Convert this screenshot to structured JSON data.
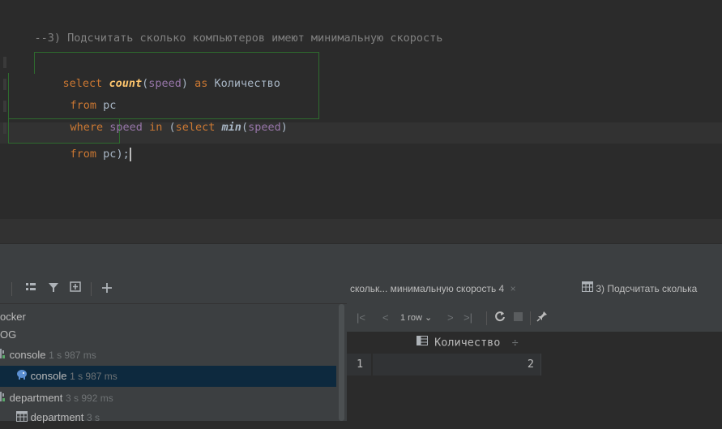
{
  "editor": {
    "comment": "--3) Подсчитать сколько компьютеров имеют минимальную скорость",
    "sql": {
      "kw_select": "select",
      "fn_count": "count",
      "col_speed": "speed",
      "kw_as": "as",
      "alias": "Количество",
      "kw_from": "from",
      "table_pc": "pc",
      "kw_where": "where",
      "kw_in": "in",
      "fn_min": "min",
      "open_paren": "(",
      "close_paren": ")",
      "close_stmt": ");"
    }
  },
  "services": {
    "toolbar_icons": [
      "layout-icon",
      "filter-icon",
      "new-group-icon",
      "add-icon"
    ],
    "tree": [
      {
        "label": "ocker",
        "time": "",
        "icon": "",
        "selected": false
      },
      {
        "label": "OG",
        "time": "",
        "icon": "",
        "selected": false
      },
      {
        "label": "console",
        "time": "1 s 987 ms",
        "icon": "console-session-icon",
        "selected": false
      },
      {
        "label": "console",
        "time": "1 s 987 ms",
        "icon": "postgres-elephant-icon",
        "selected": true
      },
      {
        "label": "department",
        "time": "3 s 992 ms",
        "icon": "console-session-icon",
        "selected": false
      },
      {
        "label": "department",
        "time": "3 s",
        "icon": "table-icon",
        "selected": false
      }
    ]
  },
  "results": {
    "tab1_label": "скольк... минимальную скорость 4",
    "tab1_close": "×",
    "tab2_label": "3) Подсчитать сколька",
    "row_count": "1 row",
    "column_header": "Количество",
    "sort_glyph": "÷",
    "row_number": "1",
    "value": "2"
  },
  "colors": {
    "editor_bg": "#2b2b2b",
    "keyword": "#cc7832",
    "function": "#ffc66d",
    "column": "#9876aa",
    "comment": "#808080",
    "selection": "#0d293e",
    "bracket_box": "#2e6b2e"
  }
}
